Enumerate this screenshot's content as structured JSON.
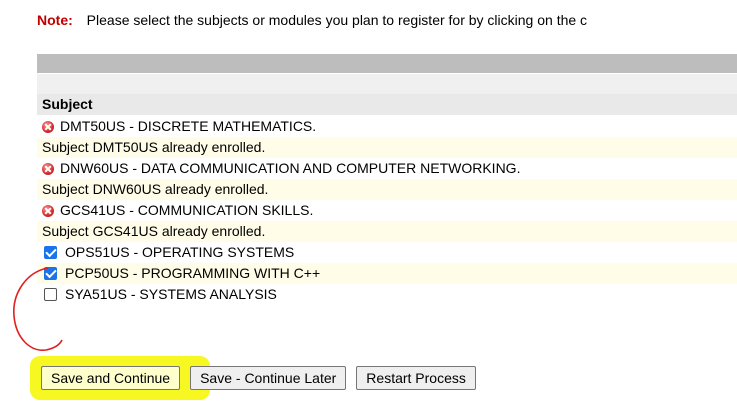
{
  "note": {
    "label": "Note:",
    "text": "Please select the subjects or modules you plan to register for by clicking on the c"
  },
  "table": {
    "header": "Subject",
    "enrolled": [
      {
        "subject": "DMT50US - DISCRETE MATHEMATICS.",
        "message": "Subject DMT50US already enrolled."
      },
      {
        "subject": "DNW60US - DATA COMMUNICATION AND COMPUTER NETWORKING.",
        "message": "Subject DNW60US already enrolled."
      },
      {
        "subject": "GCS41US - COMMUNICATION SKILLS.",
        "message": "Subject GCS41US already enrolled."
      }
    ],
    "selectable": [
      {
        "subject": "OPS51US - OPERATING SYSTEMS",
        "checked": true
      },
      {
        "subject": "PCP50US - PROGRAMMING WITH C++",
        "checked": true
      },
      {
        "subject": "SYA51US - SYSTEMS ANALYSIS",
        "checked": false
      }
    ]
  },
  "buttons": {
    "save_continue": "Save and Continue",
    "save_later": "Save - Continue Later",
    "restart": "Restart Process"
  },
  "colors": {
    "note_label": "#c00000",
    "highlight": "#f7f722",
    "annotation_circle": "#e02020",
    "checkbox_accent": "#1a73e8"
  }
}
